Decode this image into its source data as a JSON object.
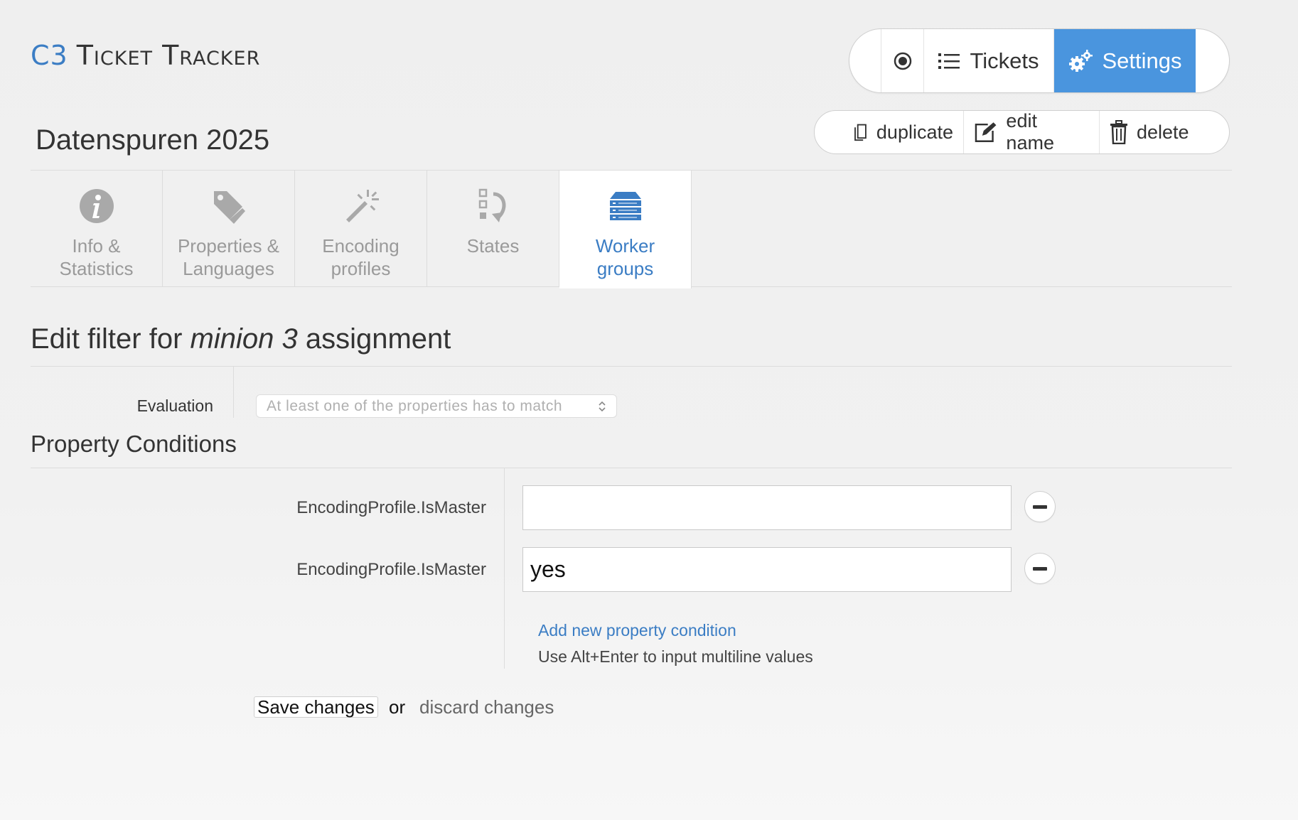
{
  "app": {
    "logo_mark": "C3",
    "logo_name": "Ticket Tracker"
  },
  "mainnav": {
    "record_icon": "record-icon",
    "tickets_label": "Tickets",
    "settings_label": "Settings",
    "active_color": "#4a95de"
  },
  "actions": {
    "duplicate_label": "duplicate",
    "edit_label": "edit name",
    "delete_label": "delete"
  },
  "project": {
    "title": "Datenspuren 2025"
  },
  "tabs": [
    {
      "label": "Info &\nStatistics",
      "icon": "info-icon",
      "active": false
    },
    {
      "label": "Properties &\nLanguages",
      "icon": "tag-icon",
      "active": false
    },
    {
      "label": "Encoding\nprofiles",
      "icon": "magic-wand-icon",
      "active": false
    },
    {
      "label": "States",
      "icon": "states-icon",
      "active": false
    },
    {
      "label": "Worker\ngroups",
      "icon": "server-icon",
      "active": true
    }
  ],
  "form": {
    "heading_prefix": "Edit filter for ",
    "heading_name": "minion 3",
    "heading_suffix": " assignment",
    "evaluation_label": "Evaluation",
    "evaluation_value": "At least one of the properties has to match",
    "conditions_heading": "Property Conditions",
    "conditions": [
      {
        "key": "EncodingProfile.IsMaster",
        "value": ""
      },
      {
        "key": "EncodingProfile.IsMaster",
        "value": "yes"
      }
    ],
    "add_condition_label": "Add new property condition",
    "hint": "Use Alt+Enter to input multiline values",
    "save_label": "Save changes",
    "or_label": "or",
    "discard_label": "discard changes"
  }
}
